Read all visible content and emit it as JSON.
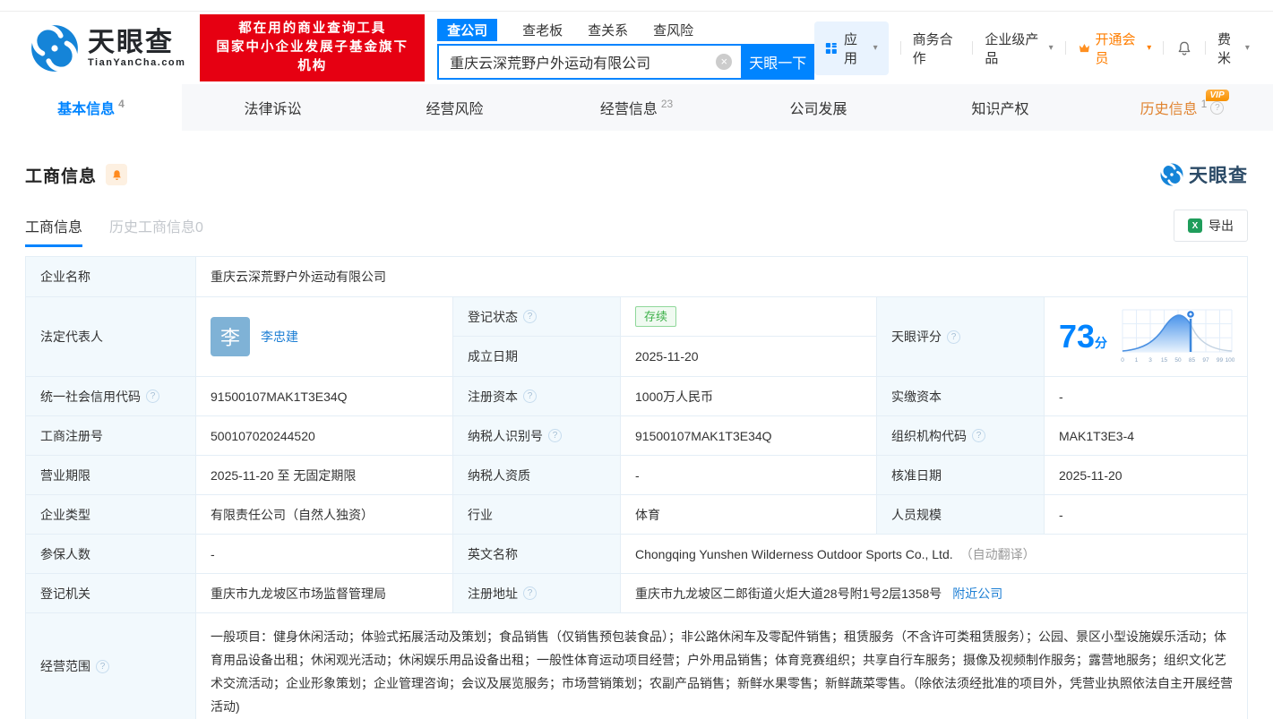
{
  "brand": {
    "name": "天眼查",
    "domain": "TianYanCha.com",
    "slogan_line1": "都在用的商业查询工具",
    "slogan_line2": "国家中小企业发展子基金旗下机构"
  },
  "colors": {
    "accent_blue": "#0084ff",
    "brand_red": "#e60012",
    "vip_orange": "#ff7e00",
    "status_green": "#3eb14a",
    "link_blue": "#1e7fd4"
  },
  "icons": {
    "help": "?",
    "clear": "×",
    "caret": "▾"
  },
  "search": {
    "tabs": [
      "查公司",
      "查老板",
      "查关系",
      "查风险"
    ],
    "value": "重庆云深荒野户外运动有限公司",
    "button": "天眼一下"
  },
  "topnav": {
    "apps": "应用",
    "cooperation": "商务合作",
    "enterprise": "企业级产品",
    "vip": "开通会员",
    "user": "费米"
  },
  "tabs": [
    {
      "label": "基本信息",
      "count": "4"
    },
    {
      "label": "法律诉讼",
      "count": ""
    },
    {
      "label": "经营风险",
      "count": ""
    },
    {
      "label": "经营信息",
      "count": "23"
    },
    {
      "label": "公司发展",
      "count": ""
    },
    {
      "label": "知识产权",
      "count": ""
    },
    {
      "label": "历史信息",
      "count": "1",
      "badge": "VIP"
    }
  ],
  "section": {
    "title": "工商信息",
    "subtab_active": "工商信息",
    "subtab_history": "历史工商信息0",
    "export": "导出",
    "excel_glyph": "X",
    "logo": "天眼查"
  },
  "fields": {
    "company_name": {
      "label": "企业名称",
      "value": "重庆云深荒野户外运动有限公司"
    },
    "legal_rep": {
      "label": "法定代表人",
      "avatar": "李",
      "name": "李忠建"
    },
    "reg_status": {
      "label": "登记状态",
      "value": "存续"
    },
    "establish_date": {
      "label": "成立日期",
      "value": "2025-11-20"
    },
    "tyc_score": {
      "label": "天眼评分",
      "score": "73",
      "unit": "分",
      "axis": [
        "0",
        "1",
        "3",
        "15",
        "50",
        "85",
        "97",
        "99",
        "100"
      ]
    },
    "credit_code": {
      "label": "统一社会信用代码",
      "value": "91500107MAK1T3E34Q"
    },
    "reg_capital": {
      "label": "注册资本",
      "value": "1000万人民币"
    },
    "paid_capital": {
      "label": "实缴资本",
      "value": "-"
    },
    "reg_number": {
      "label": "工商注册号",
      "value": "500107020244520"
    },
    "taxpayer_id": {
      "label": "纳税人识别号",
      "value": "91500107MAK1T3E34Q"
    },
    "org_code": {
      "label": "组织机构代码",
      "value": "MAK1T3E3-4"
    },
    "business_term": {
      "label": "营业期限",
      "value": "2025-11-20 至 无固定期限"
    },
    "taxpayer_qualification": {
      "label": "纳税人资质",
      "value": "-"
    },
    "approval_date": {
      "label": "核准日期",
      "value": "2025-11-20"
    },
    "company_type": {
      "label": "企业类型",
      "value": "有限责任公司（自然人独资）"
    },
    "industry": {
      "label": "行业",
      "value": "体育"
    },
    "staff_size": {
      "label": "人员规模",
      "value": "-"
    },
    "insured_count": {
      "label": "参保人数",
      "value": "-"
    },
    "english_name": {
      "label": "英文名称",
      "value": "Chongqing Yunshen Wilderness Outdoor Sports Co., Ltd.",
      "note": "（自动翻译）"
    },
    "reg_authority": {
      "label": "登记机关",
      "value": "重庆市九龙坡区市场监督管理局"
    },
    "reg_address": {
      "label": "注册地址",
      "value": "重庆市九龙坡区二郎街道火炬大道28号附1号2层1358号",
      "link": "附近公司"
    },
    "business_scope": {
      "label": "经营范围",
      "value": "一般项目：健身休闲活动；体验式拓展活动及策划；食品销售（仅销售预包装食品）；非公路休闲车及零配件销售；租赁服务（不含许可类租赁服务）；公园、景区小型设施娱乐活动；体育用品设备出租；休闲观光活动；休闲娱乐用品设备出租；一般性体育运动项目经营；户外用品销售；体育竞赛组织；共享自行车服务；摄像及视频制作服务；露营地服务；组织文化艺术交流活动；企业形象策划；企业管理咨询；会议及展览服务；市场营销策划；农副产品销售；新鲜水果零售；新鲜蔬菜零售。（除依法须经批准的项目外，凭营业执照依法自主开展经营活动)"
    }
  },
  "chart_data": {
    "type": "area",
    "title": "天眼评分分布曲线",
    "score_marker": 73,
    "x_ticks": [
      "0",
      "1",
      "3",
      "15",
      "50",
      "85",
      "97",
      "99",
      "100"
    ],
    "shape": "bell-curve, filled blue left of score marker, gray to the right"
  }
}
